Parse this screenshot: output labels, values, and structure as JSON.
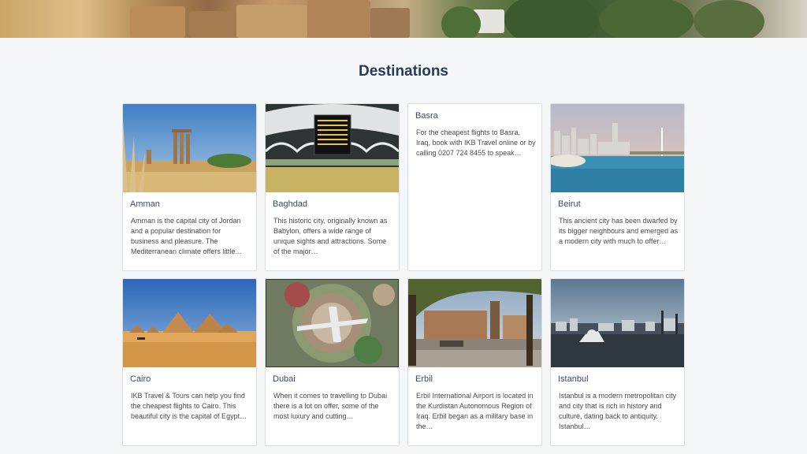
{
  "page": {
    "title": "Destinations"
  },
  "destinations": [
    {
      "name": "Amman",
      "description": "Amman is the capital city of Jordan and a popular destination for business and pleasure. The Mediterranean climate offers little…"
    },
    {
      "name": "Baghdad",
      "description": "This historic city, originally known as Babylon, offers a wide range of unique sights and attractions. Some of the major…"
    },
    {
      "name": "Basra",
      "description": "For the cheapest flights to Basra, Iraq, book with IKB Travel online or by calling 0207 724 8455 to speak…"
    },
    {
      "name": "Beirut",
      "description": "This ancient city has been dwarfed by its bigger neighbours and emerged as a modern city with much to offer…"
    },
    {
      "name": "Cairo",
      "description": "IKB Travel & Tours can help you find the cheapest flights to Cairo. This beautiful city is the capital of Egypt…"
    },
    {
      "name": "Dubai",
      "description": "When it comes to travelling to Dubai there is a lot on offer, some of the most luxury and cutting…"
    },
    {
      "name": "Erbil",
      "description": "Erbil International Airport is located in the Kurdistan Autonomous Region of Iraq. Erbil began as a military base in the…"
    },
    {
      "name": "Istanbul",
      "description": "Istanbul is a modern metropolitan city and city that is rich in history and culture, dating back to antiquity. Istanbul…"
    }
  ]
}
